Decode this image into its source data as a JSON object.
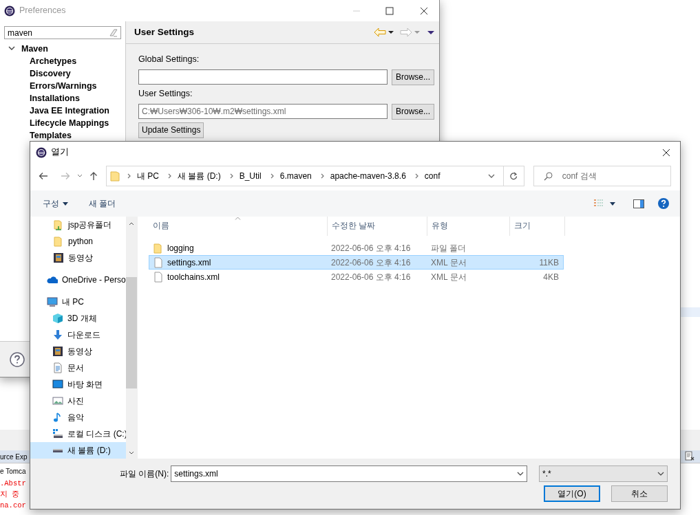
{
  "background_app": {
    "tabs": [
      {
        "label": "urce Exp"
      },
      {
        "label": "e Tomca"
      }
    ],
    "console_lines": [
      ".Abstr",
      "지 중",
      "na.cor"
    ]
  },
  "preferences": {
    "title": "Preferences",
    "filter": {
      "value": "maven"
    },
    "tree": [
      {
        "label": "Maven",
        "expanded": true,
        "children": [
          {
            "label": "Archetypes"
          },
          {
            "label": "Discovery"
          },
          {
            "label": "Errors/Warnings"
          },
          {
            "label": "Installations"
          },
          {
            "label": "Java EE Integration"
          },
          {
            "label": "Lifecycle Mappings"
          },
          {
            "label": "Templates"
          }
        ]
      }
    ],
    "page_title": "User Settings",
    "fields": [
      {
        "label": "Global Settings:",
        "button": "Browse..."
      },
      {
        "label": "User Settings:",
        "value": "C:₩Users₩306-10₩.m2₩settings.xml",
        "button": "Browse..."
      }
    ],
    "update_button": "Update Settings"
  },
  "open_dialog": {
    "title": "열기",
    "breadcrumbs": [
      "내 PC",
      "새 볼륨 (D:)",
      "B_Util",
      "6.maven",
      "apache-maven-3.8.6",
      "conf"
    ],
    "search": {
      "placeholder": "conf 검색"
    },
    "toolbar": {
      "organize": "구성",
      "new_folder": "새 폴더"
    },
    "quick_access": [
      {
        "label": "jsp공유폴더",
        "kind": "shared",
        "selected": false
      },
      {
        "label": "python",
        "kind": "folder",
        "selected": false
      },
      {
        "label": "동영상",
        "kind": "videos",
        "selected": false
      }
    ],
    "locations": [
      {
        "label": "OneDrive - Perso",
        "kind": "cloud",
        "selected": false
      },
      {
        "label": "내 PC",
        "kind": "pc",
        "selected": false,
        "children": [
          {
            "label": "3D 개체",
            "kind": "cube",
            "selected": false
          },
          {
            "label": "다운로드",
            "kind": "download",
            "selected": false
          },
          {
            "label": "동영상",
            "kind": "videos",
            "selected": false
          },
          {
            "label": "문서",
            "kind": "document",
            "selected": false
          },
          {
            "label": "바탕 화면",
            "kind": "desktop",
            "selected": false
          },
          {
            "label": "사진",
            "kind": "pictures",
            "selected": false
          },
          {
            "label": "음악",
            "kind": "music",
            "selected": false
          },
          {
            "label": "로컬 디스크 (C:)",
            "kind": "system-disk",
            "selected": false
          },
          {
            "label": "새 볼륨 (D:)",
            "kind": "disk",
            "selected": true
          }
        ]
      }
    ],
    "columns": [
      "이름",
      "수정한 날짜",
      "유형",
      "크기"
    ],
    "files": [
      {
        "name": "logging",
        "modified": "2022-06-06 오후 4:16",
        "type": "파일 폴더",
        "kind": "folder",
        "selected": false
      },
      {
        "name": "settings.xml",
        "modified": "2022-06-06 오후 4:16",
        "type": "XML 문서",
        "size": "11KB",
        "kind": "file",
        "selected": true
      },
      {
        "name": "toolchains.xml",
        "modified": "2022-06-06 오후 4:16",
        "type": "XML 문서",
        "size": "4KB",
        "kind": "file",
        "selected": false
      }
    ],
    "file_name": {
      "label": "파일 이름(N):",
      "value": "settings.xml"
    },
    "filter": {
      "value": "*.*"
    },
    "buttons": [
      {
        "label": "열기(O)",
        "kind": "primary"
      },
      {
        "label": "취소",
        "kind": "secondary"
      }
    ]
  }
}
